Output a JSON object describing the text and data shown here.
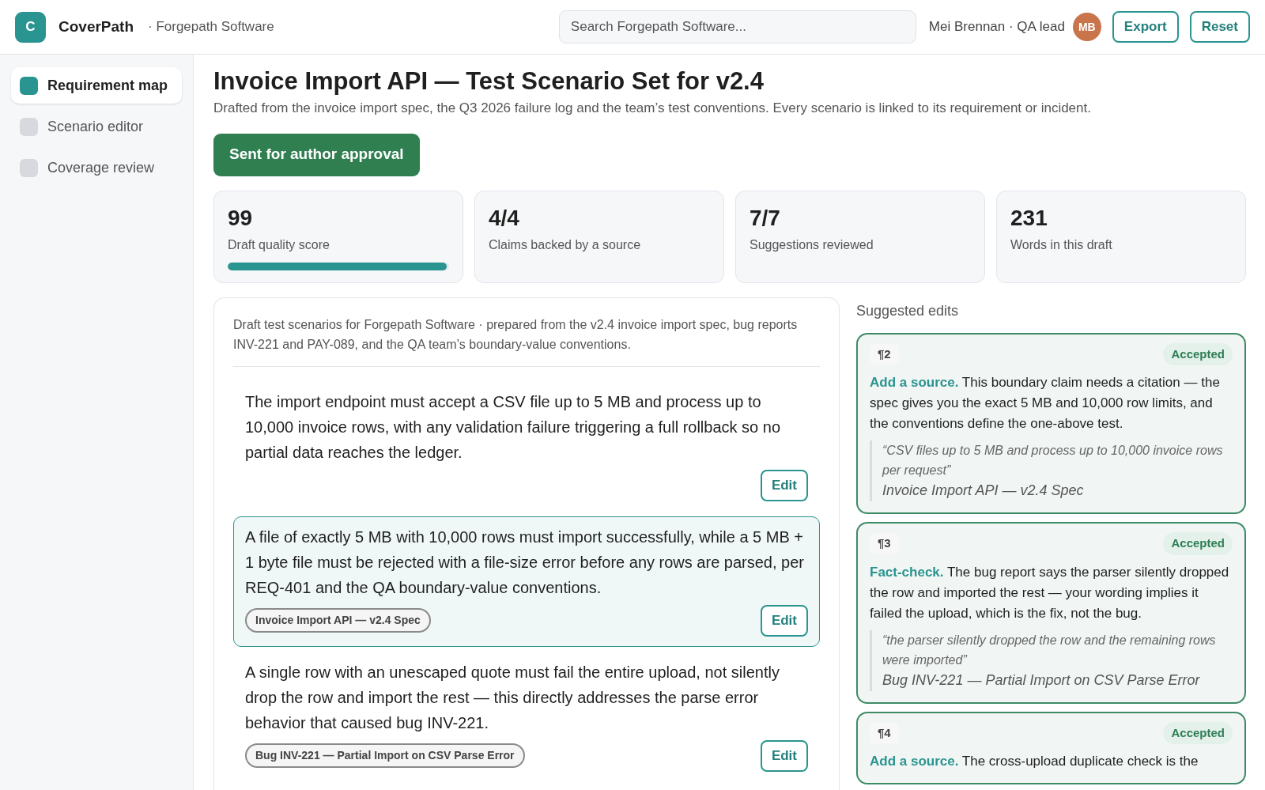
{
  "app": {
    "logo": "C",
    "name": "CoverPath",
    "workspace": "· Forgepath Software"
  },
  "search": {
    "placeholder": "Search Forgepath Software..."
  },
  "user": {
    "name": "Mei Brennan · QA lead",
    "initials": "MB"
  },
  "header_buttons": [
    "Export",
    "Reset"
  ],
  "sidebar": {
    "items": [
      {
        "label": "Requirement map",
        "selected": true
      },
      {
        "label": "Scenario editor",
        "selected": false
      },
      {
        "label": "Coverage review",
        "selected": false
      }
    ]
  },
  "page": {
    "title": "Invoice Import API — Test Scenario Set for v2.4",
    "subtitle": "Drafted from the invoice import spec, the Q3 2026 failure log and the team’s test conventions. Every scenario is linked to its requirement or incident.",
    "status_button": "Sent for author approval"
  },
  "stats": [
    {
      "value": "99",
      "label": "Draft quality score",
      "level": 0.99
    },
    {
      "value": "4/4",
      "label": "Claims backed by a source"
    },
    {
      "value": "7/7",
      "label": "Suggestions reviewed"
    },
    {
      "value": "231",
      "label": "Words in this draft"
    }
  ],
  "draft": {
    "intro": "Draft test scenarios for Forgepath Software · prepared from the v2.4 invoice import spec, bug reports INV-221 and PAY-089, and the QA team’s boundary-value conventions.",
    "paragraphs": [
      {
        "text": "The import endpoint must accept a CSV file up to 5 MB and process up to 10,000 invoice rows, with any validation failure triggering a full rollback so no partial data reaches the ledger.",
        "selected": false,
        "edit": "Edit"
      },
      {
        "text": "A file of exactly 5 MB with 10,000 rows must import successfully, while a 5 MB + 1 byte file must be rejected with a file-size error before any rows are parsed, per REQ-401 and the QA boundary-value conventions.",
        "source": "Invoice Import API — v2.4 Spec",
        "selected": true,
        "edit": "Edit"
      },
      {
        "text": "A single row with an unescaped quote must fail the entire upload, not silently drop the row and import the rest — this directly addresses the parse error behavior that caused bug INV-221.",
        "source": "Bug INV-221 — Partial Import on CSV Parse Error",
        "selected": false,
        "edit": "Edit"
      }
    ]
  },
  "suggestions": {
    "title": "Suggested edits",
    "items": [
      {
        "ref": "¶2",
        "status": "Accepted",
        "label": "Add a source.",
        "body": "This boundary claim needs a citation — the spec gives you the exact 5 MB and 10,000 row limits, and the conventions define the one-above test.",
        "quote": "“CSV files up to 5 MB and process up to 10,000 invoice rows per request”",
        "source": "Invoice Import API — v2.4 Spec"
      },
      {
        "ref": "¶3",
        "status": "Accepted",
        "label": "Fact-check.",
        "body": "The bug report says the parser silently dropped the row and imported the rest — your wording implies it failed the upload, which is the fix, not the bug.",
        "quote": "“the parser silently dropped the row and the remaining rows were imported”",
        "source": "Bug INV-221 — Partial Import on CSV Parse Error"
      },
      {
        "ref": "¶4",
        "status": "Accepted",
        "label": "Add a source.",
        "body": "The cross-upload duplicate check is the"
      }
    ]
  }
}
